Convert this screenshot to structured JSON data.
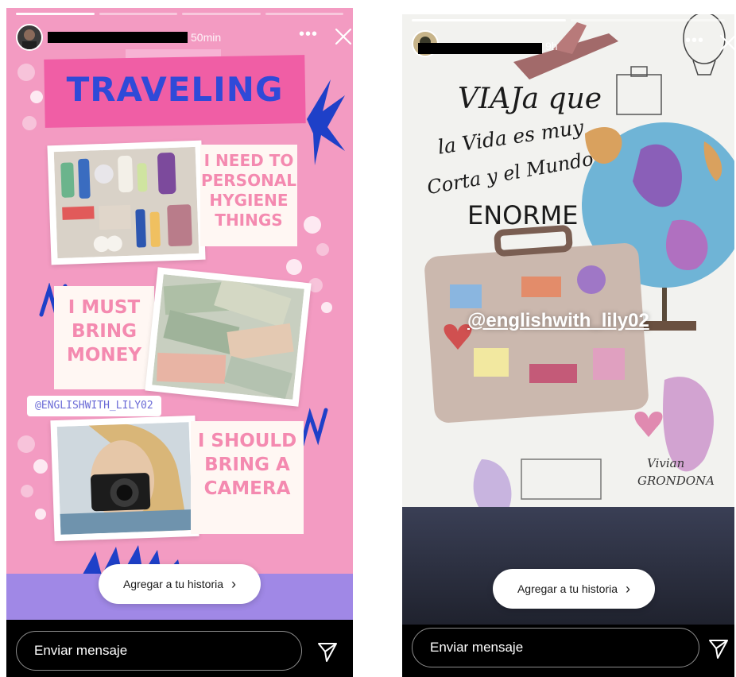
{
  "stories": [
    {
      "elapsed": "50min",
      "add_story_label": "Agregar a tu historia",
      "message_placeholder": "Enviar mensaje",
      "content": {
        "title": "TRAVELING",
        "card1": [
          "I NEED TO",
          "PERSONAL",
          "HYGIENE",
          "THINGS"
        ],
        "card2": [
          "I MUST",
          "BRING",
          "MONEY"
        ],
        "card3": [
          "I SHOULD",
          "BRING A",
          "CAMERA"
        ],
        "handle": "@ENGLISHWITH_LILY02"
      }
    },
    {
      "elapsed": "9h",
      "add_story_label": "Agregar a tu historia",
      "message_placeholder": "Enviar mensaje",
      "content": {
        "quote_lines": [
          "VIAJa que",
          "la Vida es muy",
          "Corta y el Mundo",
          "ENORME"
        ],
        "handle": "@englishwith_lily02",
        "signature": [
          "Vivian",
          "GRONDONA"
        ]
      }
    }
  ],
  "icons": {
    "more": "more-options-icon",
    "close": "close-icon",
    "send": "send-icon",
    "chevron": "chevron-right-icon"
  },
  "colors": {
    "left_bg": "#f39bc2",
    "title_blue": "#2f4ad8",
    "card_text_pink": "#f48ab0",
    "lavender": "#a088e6"
  }
}
